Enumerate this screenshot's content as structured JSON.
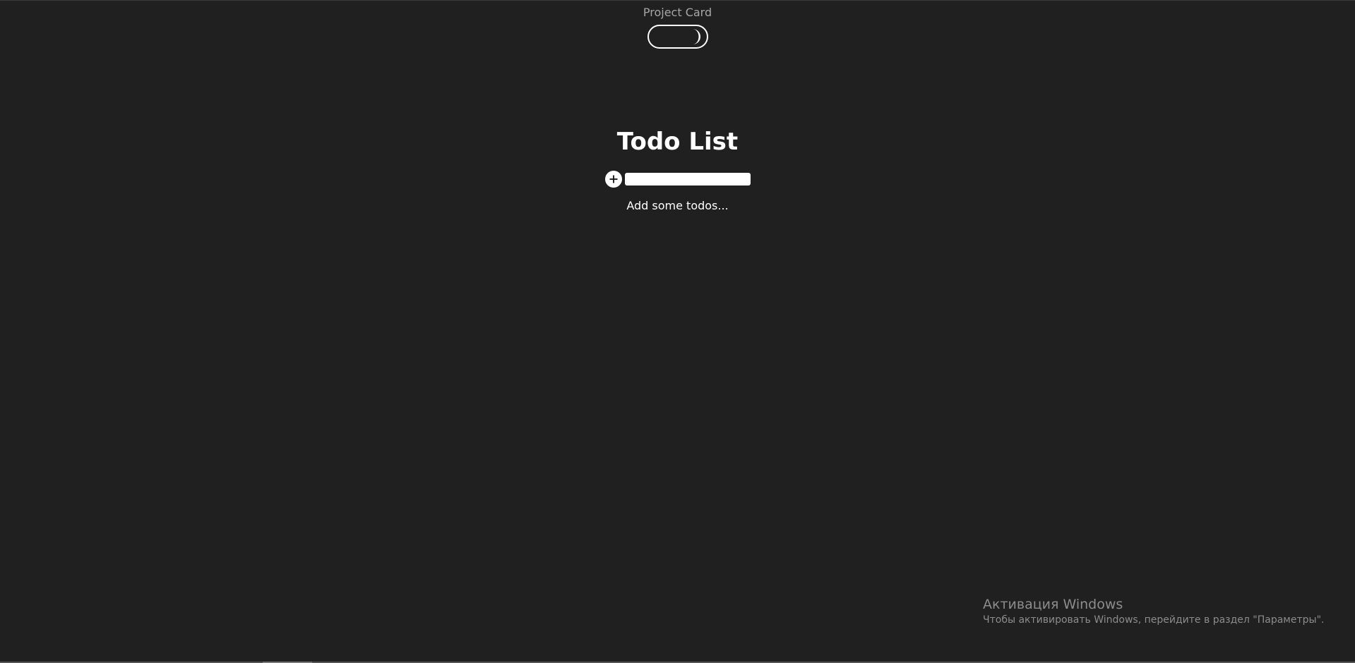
{
  "header": {
    "project_link": "Project Card"
  },
  "theme_toggle": {
    "mode": "dark",
    "icon": "moon-icon"
  },
  "main": {
    "title": "Todo List",
    "add_button_icon": "plus-icon",
    "input": {
      "value": "",
      "placeholder": ""
    },
    "empty_message": "Add some todos..."
  },
  "os_watermark": {
    "title": "Активация Windows",
    "subtitle": "Чтобы активировать Windows, перейдите в раздел \"Параметры\"."
  },
  "colors": {
    "background": "#202020",
    "text": "#ffffff",
    "muted_text": "#a6a6a6",
    "watermark_text": "#8c8c8c"
  }
}
